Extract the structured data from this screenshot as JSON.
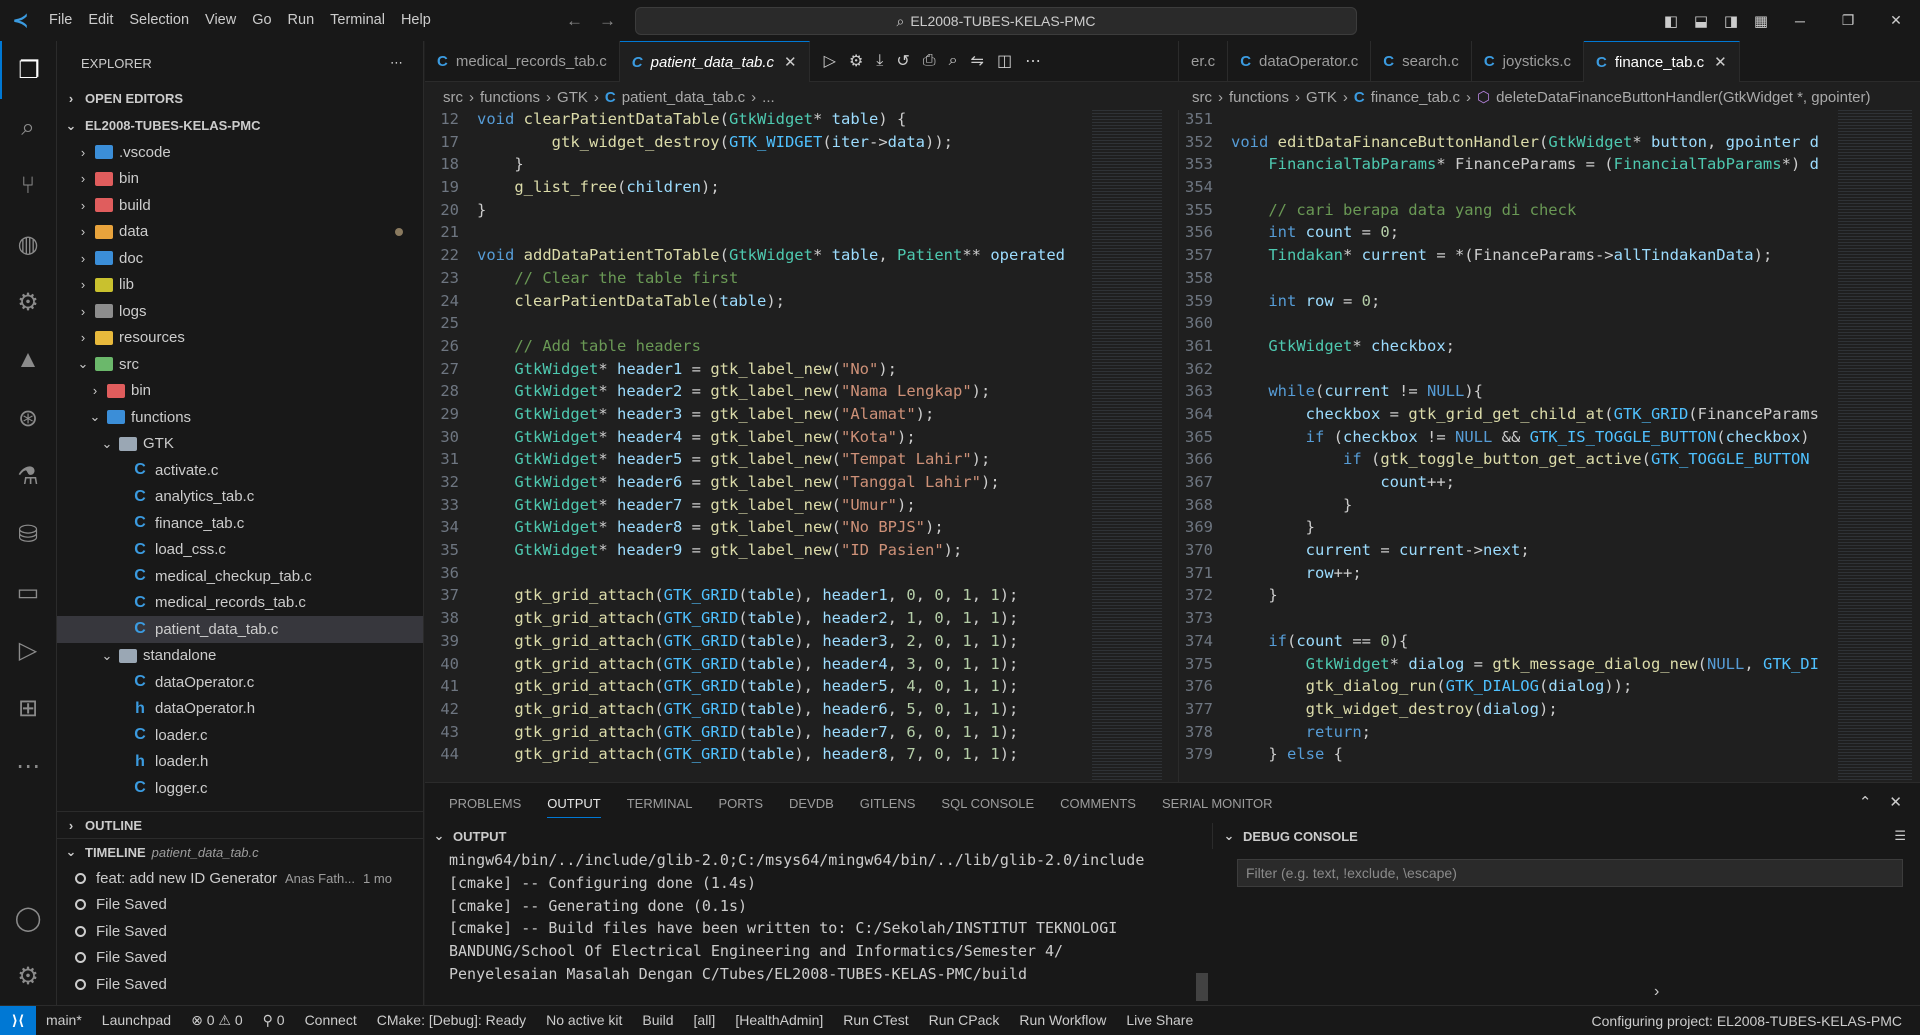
{
  "titlebar": {
    "menu": [
      "File",
      "Edit",
      "Selection",
      "View",
      "Go",
      "Run",
      "Terminal",
      "Help"
    ],
    "search_text": "EL2008-TUBES-KELAS-PMC"
  },
  "sidebar": {
    "title": "EXPLORER",
    "open_editors": "OPEN EDITORS",
    "root": "EL2008-TUBES-KELAS-PMC",
    "tree": [
      {
        "label": ".vscode",
        "indent": 1,
        "color": "#3b8ed8"
      },
      {
        "label": "bin",
        "indent": 1,
        "color": "#e05d5d"
      },
      {
        "label": "build",
        "indent": 1,
        "color": "#e05d5d"
      },
      {
        "label": "data",
        "indent": 1,
        "color": "#e8a33c"
      },
      {
        "label": "doc",
        "indent": 1,
        "color": "#3b8ed8"
      },
      {
        "label": "lib",
        "indent": 1,
        "color": "#c9c12e"
      },
      {
        "label": "logs",
        "indent": 1,
        "color": "#8d8d8d"
      },
      {
        "label": "resources",
        "indent": 1,
        "color": "#e8b93c"
      },
      {
        "label": "src",
        "indent": 1,
        "color": "#6bb86b"
      },
      {
        "label": "bin",
        "indent": 2,
        "color": "#e05d5d"
      },
      {
        "label": "functions",
        "indent": 2,
        "color": "#3b8ed8"
      },
      {
        "label": "GTK",
        "indent": 3,
        "color": "#9aa7b4"
      },
      {
        "label": "activate.c",
        "indent": 4
      },
      {
        "label": "analytics_tab.c",
        "indent": 4
      },
      {
        "label": "finance_tab.c",
        "indent": 4
      },
      {
        "label": "load_css.c",
        "indent": 4
      },
      {
        "label": "medical_checkup_tab.c",
        "indent": 4
      },
      {
        "label": "medical_records_tab.c",
        "indent": 4
      },
      {
        "label": "patient_data_tab.c",
        "indent": 4
      },
      {
        "label": "standalone",
        "indent": 3,
        "color": "#9aa7b4"
      },
      {
        "label": "dataOperator.c",
        "indent": 4
      },
      {
        "label": "dataOperator.h",
        "indent": 4
      },
      {
        "label": "loader.c",
        "indent": 4
      },
      {
        "label": "loader.h",
        "indent": 4
      },
      {
        "label": "logger.c",
        "indent": 4
      }
    ],
    "outline": "OUTLINE",
    "timeline": "TIMELINE",
    "timeline_file": "patient_data_tab.c",
    "timeline_items": [
      {
        "label": "feat: add new ID Generator",
        "author": "Anas Fath...",
        "time": "1 mo"
      },
      {
        "label": "File Saved"
      },
      {
        "label": "File Saved"
      },
      {
        "label": "File Saved"
      },
      {
        "label": "File Saved"
      }
    ]
  },
  "editor_left": {
    "tabs": [
      "medical_records_tab.c",
      "patient_data_tab.c"
    ],
    "breadcrumb": [
      "src",
      "functions",
      "GTK",
      "patient_data_tab.c",
      "..."
    ],
    "lines": [
      {
        "n": "12",
        "t": "void clearPatientDataTable(GtkWidget* table) {"
      },
      {
        "n": "17",
        "t": "        gtk_widget_destroy(GTK_WIDGET(iter->data));"
      },
      {
        "n": "18",
        "t": "    }"
      },
      {
        "n": "19",
        "t": "    g_list_free(children);"
      },
      {
        "n": "20",
        "t": "}"
      },
      {
        "n": "21",
        "t": ""
      },
      {
        "n": "22",
        "t": "void addDataPatientToTable(GtkWidget* table, Patient** operated"
      },
      {
        "n": "23",
        "t": "    // Clear the table first"
      },
      {
        "n": "24",
        "t": "    clearPatientDataTable(table);"
      },
      {
        "n": "25",
        "t": ""
      },
      {
        "n": "26",
        "t": "    // Add table headers"
      },
      {
        "n": "27",
        "t": "    GtkWidget* header1 = gtk_label_new(\"No\");"
      },
      {
        "n": "28",
        "t": "    GtkWidget* header2 = gtk_label_new(\"Nama Lengkap\");"
      },
      {
        "n": "29",
        "t": "    GtkWidget* header3 = gtk_label_new(\"Alamat\");"
      },
      {
        "n": "30",
        "t": "    GtkWidget* header4 = gtk_label_new(\"Kota\");"
      },
      {
        "n": "31",
        "t": "    GtkWidget* header5 = gtk_label_new(\"Tempat Lahir\");"
      },
      {
        "n": "32",
        "t": "    GtkWidget* header6 = gtk_label_new(\"Tanggal Lahir\");"
      },
      {
        "n": "33",
        "t": "    GtkWidget* header7 = gtk_label_new(\"Umur\");"
      },
      {
        "n": "34",
        "t": "    GtkWidget* header8 = gtk_label_new(\"No BPJS\");"
      },
      {
        "n": "35",
        "t": "    GtkWidget* header9 = gtk_label_new(\"ID Pasien\");"
      },
      {
        "n": "36",
        "t": ""
      },
      {
        "n": "37",
        "t": "    gtk_grid_attach(GTK_GRID(table), header1, 0, 0, 1, 1);"
      },
      {
        "n": "38",
        "t": "    gtk_grid_attach(GTK_GRID(table), header2, 1, 0, 1, 1);"
      },
      {
        "n": "39",
        "t": "    gtk_grid_attach(GTK_GRID(table), header3, 2, 0, 1, 1);"
      },
      {
        "n": "40",
        "t": "    gtk_grid_attach(GTK_GRID(table), header4, 3, 0, 1, 1);"
      },
      {
        "n": "41",
        "t": "    gtk_grid_attach(GTK_GRID(table), header5, 4, 0, 1, 1);"
      },
      {
        "n": "42",
        "t": "    gtk_grid_attach(GTK_GRID(table), header6, 5, 0, 1, 1);"
      },
      {
        "n": "43",
        "t": "    gtk_grid_attach(GTK_GRID(table), header7, 6, 0, 1, 1);"
      },
      {
        "n": "44",
        "t": "    gtk_grid_attach(GTK_GRID(table), header8, 7, 0, 1, 1);"
      }
    ]
  },
  "editor_right": {
    "tabs": [
      "er.c",
      "dataOperator.c",
      "search.c",
      "joysticks.c",
      "finance_tab.c"
    ],
    "breadcrumb": [
      "src",
      "functions",
      "GTK",
      "finance_tab.c",
      "deleteDataFinanceButtonHandler(GtkWidget *, gpointer)"
    ],
    "lines": [
      {
        "n": "351",
        "t": ""
      },
      {
        "n": "352",
        "t": "void editDataFinanceButtonHandler(GtkWidget* button, gpointer d"
      },
      {
        "n": "353",
        "t": "    FinancialTabParams* FinanceParams = (FinancialTabParams*) d"
      },
      {
        "n": "354",
        "t": ""
      },
      {
        "n": "355",
        "t": "    // cari berapa data yang di check"
      },
      {
        "n": "356",
        "t": "    int count = 0;"
      },
      {
        "n": "357",
        "t": "    Tindakan* current = *(FinanceParams->allTindakanData);"
      },
      {
        "n": "358",
        "t": ""
      },
      {
        "n": "359",
        "t": "    int row = 0;"
      },
      {
        "n": "360",
        "t": ""
      },
      {
        "n": "361",
        "t": "    GtkWidget* checkbox;"
      },
      {
        "n": "362",
        "t": ""
      },
      {
        "n": "363",
        "t": "    while(current != NULL){"
      },
      {
        "n": "364",
        "t": "        checkbox = gtk_grid_get_child_at(GTK_GRID(FinanceParams"
      },
      {
        "n": "365",
        "t": "        if (checkbox != NULL && GTK_IS_TOGGLE_BUTTON(checkbox)"
      },
      {
        "n": "366",
        "t": "            if (gtk_toggle_button_get_active(GTK_TOGGLE_BUTTON"
      },
      {
        "n": "367",
        "t": "                count++;"
      },
      {
        "n": "368",
        "t": "            }"
      },
      {
        "n": "369",
        "t": "        }"
      },
      {
        "n": "370",
        "t": "        current = current->next;"
      },
      {
        "n": "371",
        "t": "        row++;"
      },
      {
        "n": "372",
        "t": "    }"
      },
      {
        "n": "373",
        "t": ""
      },
      {
        "n": "374",
        "t": "    if(count == 0){"
      },
      {
        "n": "375",
        "t": "        GtkWidget* dialog = gtk_message_dialog_new(NULL, GTK_DI"
      },
      {
        "n": "376",
        "t": "        gtk_dialog_run(GTK_DIALOG(dialog));"
      },
      {
        "n": "377",
        "t": "        gtk_widget_destroy(dialog);"
      },
      {
        "n": "378",
        "t": "        return;"
      },
      {
        "n": "379",
        "t": "    } else {"
      }
    ]
  },
  "panel": {
    "tabs": [
      "PROBLEMS",
      "OUTPUT",
      "TERMINAL",
      "PORTS",
      "DEVDB",
      "GITLENS",
      "SQL CONSOLE",
      "COMMENTS",
      "SERIAL MONITOR"
    ],
    "output_title": "OUTPUT",
    "output_lines": [
      "mingw64/bin/../include/glib-2.0;C:/msys64/mingw64/bin/../lib/glib-2.0/include",
      "[cmake] -- Configuring done (1.4s)",
      "[cmake] -- Generating done (0.1s)",
      "[cmake] -- Build files have been written to: C:/Sekolah/INSTITUT TEKNOLOGI",
      "BANDUNG/School Of Electrical Engineering and Informatics/Semester 4/",
      "Penyelesaian Masalah Dengan C/Tubes/EL2008-TUBES-KELAS-PMC/build"
    ],
    "debug_title": "DEBUG CONSOLE",
    "debug_filter_placeholder": "Filter (e.g. text, !exclude, \\escape)"
  },
  "statusbar": {
    "items": [
      "main*",
      "Launchpad",
      "⊗ 0 ⚠ 0",
      "⚲ 0",
      "Connect",
      "CMake: [Debug]: Ready",
      "No active kit",
      "Build",
      "[all]",
      "[HealthAdmin]",
      "Run CTest",
      "Run CPack",
      "Run Workflow",
      "Live Share"
    ],
    "right": "Configuring project: EL2008-TUBES-KELAS-PMC"
  },
  "colors": {
    "accent": "#0078d4",
    "keyword": "#569cd6",
    "string": "#ce9178",
    "comment": "#6a9955",
    "function": "#dcdcaa",
    "type": "#4ec9b0",
    "number": "#b5cea8",
    "macro": "#4fc1ff"
  }
}
